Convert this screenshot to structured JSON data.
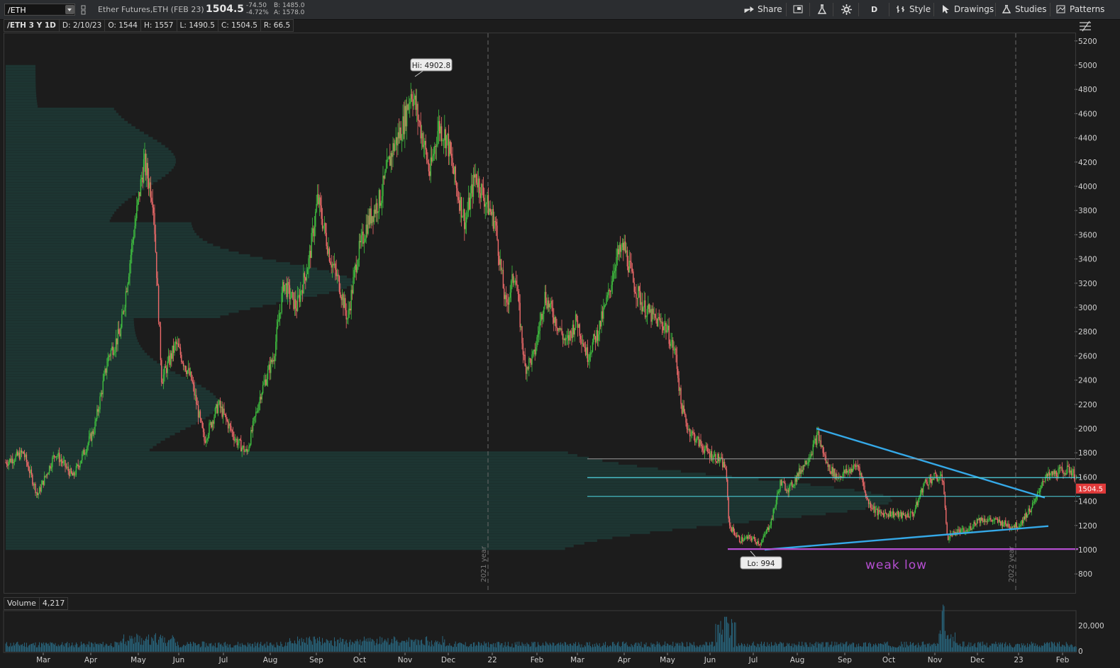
{
  "toolbar": {
    "symbol": "/ETH",
    "description": "Ether Futures,ETH (FEB 23)",
    "last": "1504.5",
    "net_change": "-74.50",
    "pct_change": "-4.72%",
    "bid": "B: 1485.0",
    "ask": "A: 1578.0",
    "share_label": "Share",
    "aggregation": "D",
    "style_label": "Style",
    "drawings_label": "Drawings",
    "studies_label": "Studies",
    "patterns_label": "Patterns"
  },
  "infobar": {
    "chart_label": "/ETH 3 Y 1D",
    "date": "D: 2/10/23",
    "open": "O: 1544",
    "high": "H: 1557",
    "low": "L: 1490.5",
    "close": "C: 1504.5",
    "range": "R: 66.5"
  },
  "volume_pane": {
    "label": "Volume",
    "value": "4,217",
    "tick": "20,000",
    "tick_zero": "0"
  },
  "colors": {
    "up": "#3fbf3f",
    "down": "#ef6a6a",
    "trend": "#35a9e8",
    "support": "#b44ed0",
    "level": "#4fd3e0",
    "profile": "#1d3a36"
  },
  "chart_data": {
    "type": "candlestick",
    "y_ticks": [
      800,
      1000,
      1200,
      1400,
      1600,
      1800,
      2000,
      2200,
      2400,
      2600,
      2800,
      3000,
      3200,
      3400,
      3600,
      3800,
      4000,
      4200,
      4400,
      4600,
      4800,
      5000,
      5200
    ],
    "ylim": [
      720,
      5280
    ],
    "x_labels": [
      "Mar",
      "Apr",
      "May",
      "Jun",
      "Jul",
      "Aug",
      "Sep",
      "Oct",
      "Nov",
      "Dec",
      "22",
      "Feb",
      "Mar",
      "Apr",
      "May",
      "Jun",
      "Jul",
      "Aug",
      "Sep",
      "Oct",
      "Nov",
      "Dec",
      "23",
      "Feb"
    ],
    "year_markers": [
      "2021 year",
      "2022 year"
    ],
    "last_price": "1504.5",
    "callouts": {
      "high": "Hi: 4902.8",
      "low": "Lo: 994"
    },
    "annotation_text": "weak low",
    "price_path": [
      {
        "d": 0,
        "p": 1720
      },
      {
        "d": 25,
        "p": 1800
      },
      {
        "d": 45,
        "p": 1450
      },
      {
        "d": 70,
        "p": 1800
      },
      {
        "d": 95,
        "p": 1600
      },
      {
        "d": 125,
        "p": 2000
      },
      {
        "d": 145,
        "p": 2600
      },
      {
        "d": 162,
        "p": 2800
      },
      {
        "d": 180,
        "p": 3600
      },
      {
        "d": 195,
        "p": 4200
      },
      {
        "d": 208,
        "p": 3900
      },
      {
        "d": 220,
        "p": 2400
      },
      {
        "d": 240,
        "p": 2700
      },
      {
        "d": 262,
        "p": 2400
      },
      {
        "d": 280,
        "p": 1900
      },
      {
        "d": 300,
        "p": 2200
      },
      {
        "d": 325,
        "p": 1900
      },
      {
        "d": 340,
        "p": 1800
      },
      {
        "d": 360,
        "p": 2300
      },
      {
        "d": 378,
        "p": 2600
      },
      {
        "d": 392,
        "p": 3200
      },
      {
        "d": 410,
        "p": 3000
      },
      {
        "d": 428,
        "p": 3400
      },
      {
        "d": 440,
        "p": 3900
      },
      {
        "d": 458,
        "p": 3400
      },
      {
        "d": 470,
        "p": 3200
      },
      {
        "d": 482,
        "p": 2900
      },
      {
        "d": 495,
        "p": 3400
      },
      {
        "d": 510,
        "p": 3700
      },
      {
        "d": 528,
        "p": 3900
      },
      {
        "d": 545,
        "p": 4300
      },
      {
        "d": 560,
        "p": 4500
      },
      {
        "d": 572,
        "p": 4800
      },
      {
        "d": 588,
        "p": 4400
      },
      {
        "d": 598,
        "p": 4100
      },
      {
        "d": 610,
        "p": 4500
      },
      {
        "d": 622,
        "p": 4400
      },
      {
        "d": 635,
        "p": 4000
      },
      {
        "d": 648,
        "p": 3700
      },
      {
        "d": 662,
        "p": 4100
      },
      {
        "d": 675,
        "p": 3900
      },
      {
        "d": 690,
        "p": 3700
      },
      {
        "d": 705,
        "p": 3000
      },
      {
        "d": 718,
        "p": 3300
      },
      {
        "d": 732,
        "p": 2500
      },
      {
        "d": 745,
        "p": 2600
      },
      {
        "d": 760,
        "p": 3100
      },
      {
        "d": 775,
        "p": 2900
      },
      {
        "d": 790,
        "p": 2700
      },
      {
        "d": 805,
        "p": 2900
      },
      {
        "d": 820,
        "p": 2600
      },
      {
        "d": 835,
        "p": 2800
      },
      {
        "d": 850,
        "p": 3100
      },
      {
        "d": 860,
        "p": 3400
      },
      {
        "d": 872,
        "p": 3500
      },
      {
        "d": 885,
        "p": 3200
      },
      {
        "d": 900,
        "p": 3000
      },
      {
        "d": 915,
        "p": 2900
      },
      {
        "d": 930,
        "p": 2850
      },
      {
        "d": 945,
        "p": 2600
      },
      {
        "d": 952,
        "p": 2200
      },
      {
        "d": 962,
        "p": 2000
      },
      {
        "d": 975,
        "p": 1900
      },
      {
        "d": 990,
        "p": 1800
      },
      {
        "d": 1005,
        "p": 1750
      },
      {
        "d": 1015,
        "p": 1680
      },
      {
        "d": 1020,
        "p": 1200
      },
      {
        "d": 1035,
        "p": 1080
      },
      {
        "d": 1050,
        "p": 1100
      },
      {
        "d": 1065,
        "p": 1050
      },
      {
        "d": 1080,
        "p": 1250
      },
      {
        "d": 1092,
        "p": 1550
      },
      {
        "d": 1105,
        "p": 1500
      },
      {
        "d": 1120,
        "p": 1650
      },
      {
        "d": 1135,
        "p": 1800
      },
      {
        "d": 1145,
        "p": 1950
      },
      {
        "d": 1158,
        "p": 1700
      },
      {
        "d": 1172,
        "p": 1600
      },
      {
        "d": 1188,
        "p": 1650
      },
      {
        "d": 1202,
        "p": 1700
      },
      {
        "d": 1215,
        "p": 1400
      },
      {
        "d": 1230,
        "p": 1300
      },
      {
        "d": 1248,
        "p": 1300
      },
      {
        "d": 1265,
        "p": 1280
      },
      {
        "d": 1280,
        "p": 1300
      },
      {
        "d": 1295,
        "p": 1550
      },
      {
        "d": 1310,
        "p": 1600
      },
      {
        "d": 1322,
        "p": 1580
      },
      {
        "d": 1327,
        "p": 1100
      },
      {
        "d": 1340,
        "p": 1150
      },
      {
        "d": 1355,
        "p": 1150
      },
      {
        "d": 1370,
        "p": 1250
      },
      {
        "d": 1385,
        "p": 1250
      },
      {
        "d": 1400,
        "p": 1230
      },
      {
        "d": 1415,
        "p": 1200
      },
      {
        "d": 1428,
        "p": 1200
      },
      {
        "d": 1440,
        "p": 1300
      },
      {
        "d": 1452,
        "p": 1400
      },
      {
        "d": 1462,
        "p": 1580
      },
      {
        "d": 1475,
        "p": 1620
      },
      {
        "d": 1490,
        "p": 1650
      },
      {
        "d": 1500,
        "p": 1660
      },
      {
        "d": 1510,
        "p": 1600
      },
      {
        "d": 1512,
        "p": 1504
      }
    ],
    "lines": [
      {
        "name": "descending-trendline",
        "from": {
          "d": 1143,
          "p": 2000
        },
        "to": {
          "d": 1465,
          "p": 1430
        }
      },
      {
        "name": "ascending-trendline",
        "from": {
          "d": 1070,
          "p": 1000
        },
        "to": {
          "d": 1470,
          "p": 1195
        }
      },
      {
        "name": "support-line",
        "from": {
          "d": 1018,
          "p": 1005
        },
        "to": {
          "d": 1512,
          "p": 1005
        }
      },
      {
        "name": "level-1400",
        "from": {
          "d": 820,
          "p": 1440
        },
        "to": {
          "d": 1515,
          "p": 1440
        }
      },
      {
        "name": "level-1600",
        "from": {
          "d": 820,
          "p": 1595
        },
        "to": {
          "d": 1515,
          "p": 1595
        }
      },
      {
        "name": "level-1740",
        "from": {
          "d": 820,
          "p": 1750
        },
        "to": {
          "d": 1515,
          "p": 1750
        }
      }
    ]
  }
}
